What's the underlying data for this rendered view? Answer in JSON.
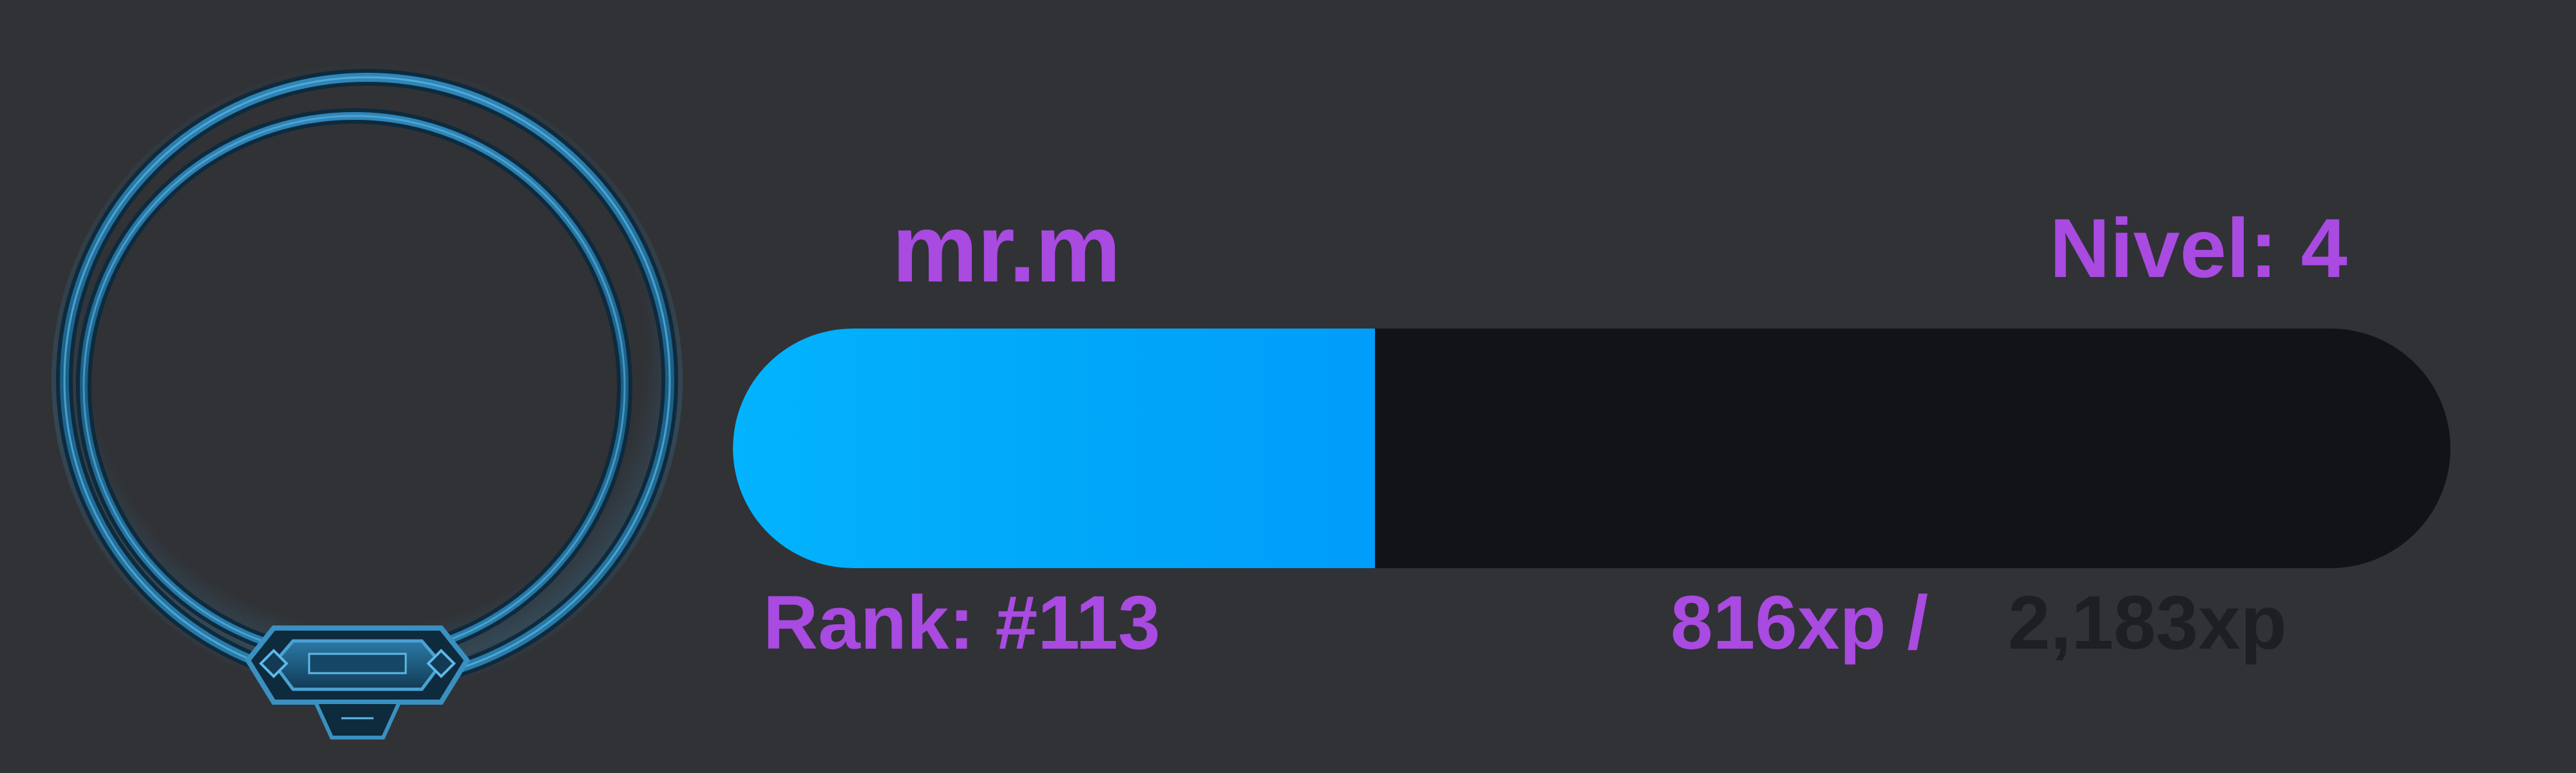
{
  "profile": {
    "username": "mr.m",
    "level_label": "Nivel: ",
    "level_value": "4",
    "rank_label": "Rank: ",
    "rank_value": "#113"
  },
  "xp": {
    "current_text": "816xp /",
    "total_text": "2,183xp",
    "current": 816,
    "total": 2183,
    "progress_fraction": 0.3738
  },
  "icons": {
    "avatar_frame": "ornate-ring-frame-icon"
  },
  "colors": {
    "background": "#303236",
    "accent_text": "#a94ae0",
    "progress_fill": "#00a6f9",
    "progress_track": "#121316",
    "frame": "#1f6f9c",
    "muted_text": "#1e1f22"
  }
}
